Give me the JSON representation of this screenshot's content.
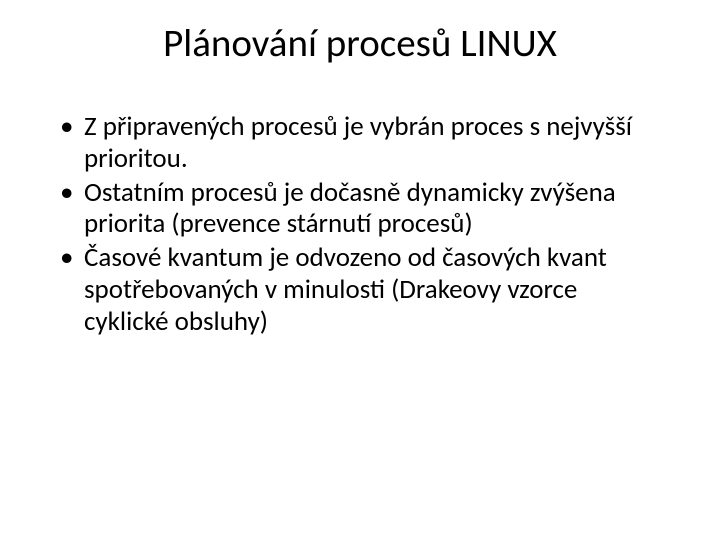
{
  "slide": {
    "title": "Plánování procesů LINUX",
    "bullets": [
      "Z připravených procesů je vybrán proces s nejvyšší prioritou.",
      "Ostatním procesů je dočasně dynamicky zvýšena priorita (prevence stárnutí procesů)",
      "Časové kvantum je odvozeno od časových kvant spotřebovaných v minulosti (Drakeovy vzorce cyklické obsluhy)"
    ]
  }
}
